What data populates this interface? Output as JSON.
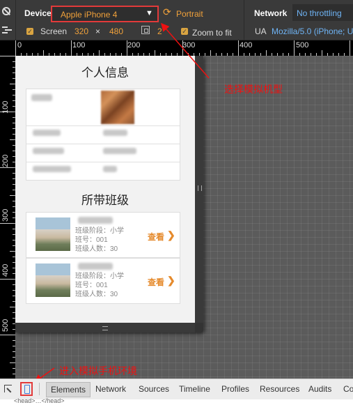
{
  "toolbar": {
    "device_label": "Device",
    "device_value": "Apple iPhone 4",
    "orientation_label": "Portrait",
    "network_label": "Network",
    "network_value": "No throttling",
    "screen_label": "Screen",
    "screen_width": "320",
    "times": "×",
    "screen_height": "480",
    "pixel_ratio": "2",
    "zoom_label": "Zoom to fit",
    "ua_label": "UA",
    "ua_value": "Mozilla/5.0 (iPhone; U;"
  },
  "ruler": {
    "x_ticks": [
      "0",
      "100",
      "200",
      "300",
      "400",
      "500"
    ],
    "y_ticks": [
      "100",
      "200",
      "300",
      "400",
      "500"
    ]
  },
  "page": {
    "personal_title": "个人信息",
    "classes_title": "所带班级",
    "classes": [
      {
        "stage": "班级阶段：小学",
        "number": "班号：001",
        "count": "班级人数：30",
        "action": "查看"
      },
      {
        "stage": "班级阶段：小学",
        "number": "班号：001",
        "count": "班级人数：30",
        "action": "查看"
      }
    ]
  },
  "annotations": {
    "select_model": "选择模拟机型",
    "enter_emulation": "进入模拟手机环境"
  },
  "tabs": [
    "Elements",
    "Network",
    "Sources",
    "Timeline",
    "Profiles",
    "Resources",
    "Audits",
    "Co"
  ],
  "status_text": "<head>…</head>",
  "colors": {
    "accent": "#f0a13a",
    "highlight": "#e23a3a",
    "link": "#6fb4f5",
    "view": "#e58a2c"
  }
}
